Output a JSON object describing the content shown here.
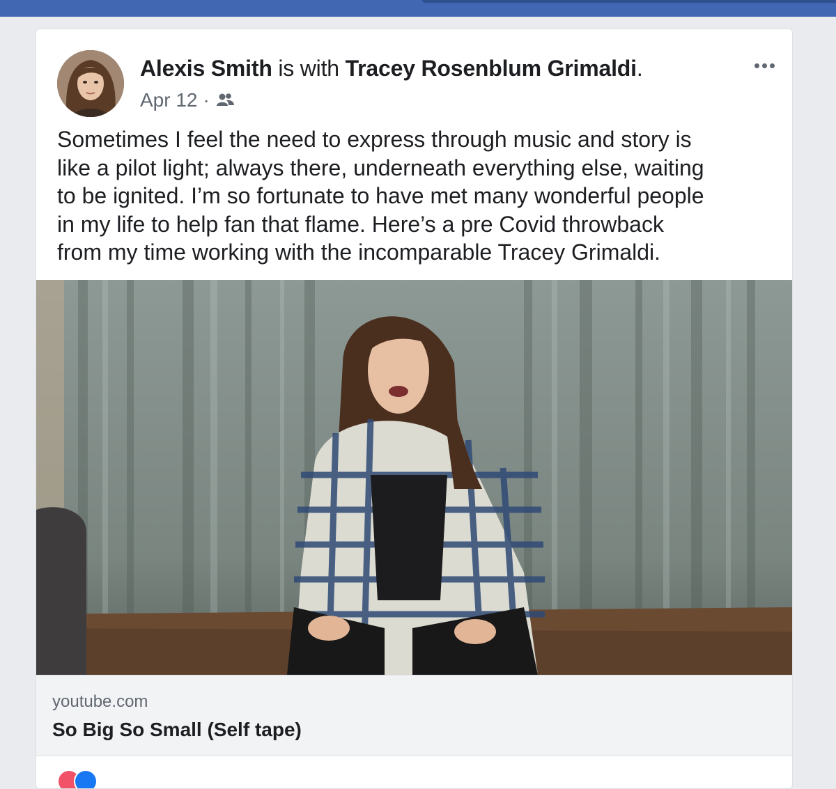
{
  "post": {
    "author": "Alexis Smith",
    "with_text": " is with ",
    "tagged": "Tracey Rosenblum Grimaldi",
    "period": ".",
    "date": "Apr 12",
    "separator": "·",
    "audience_icon": "friends-icon",
    "more_icon": "more-options-icon",
    "text": "Sometimes I feel the need to express through music and story is\nlike a pilot light; always there, underneath everything else, waiting\nto be ignited. I’m so fortunate to have met many wonderful people\nin my life to help fan that flame. Here’s a pre Covid throwback\nfrom my time working with the incomparable Tracey Grimaldi."
  },
  "link": {
    "domain": "youtube.com",
    "title": "So Big So Small (Self tape)"
  },
  "colors": {
    "facebook_blue": "#4267b2",
    "text": "#1c1e21",
    "secondary_text": "#606770",
    "love": "#f25268",
    "like": "#1877f2"
  }
}
